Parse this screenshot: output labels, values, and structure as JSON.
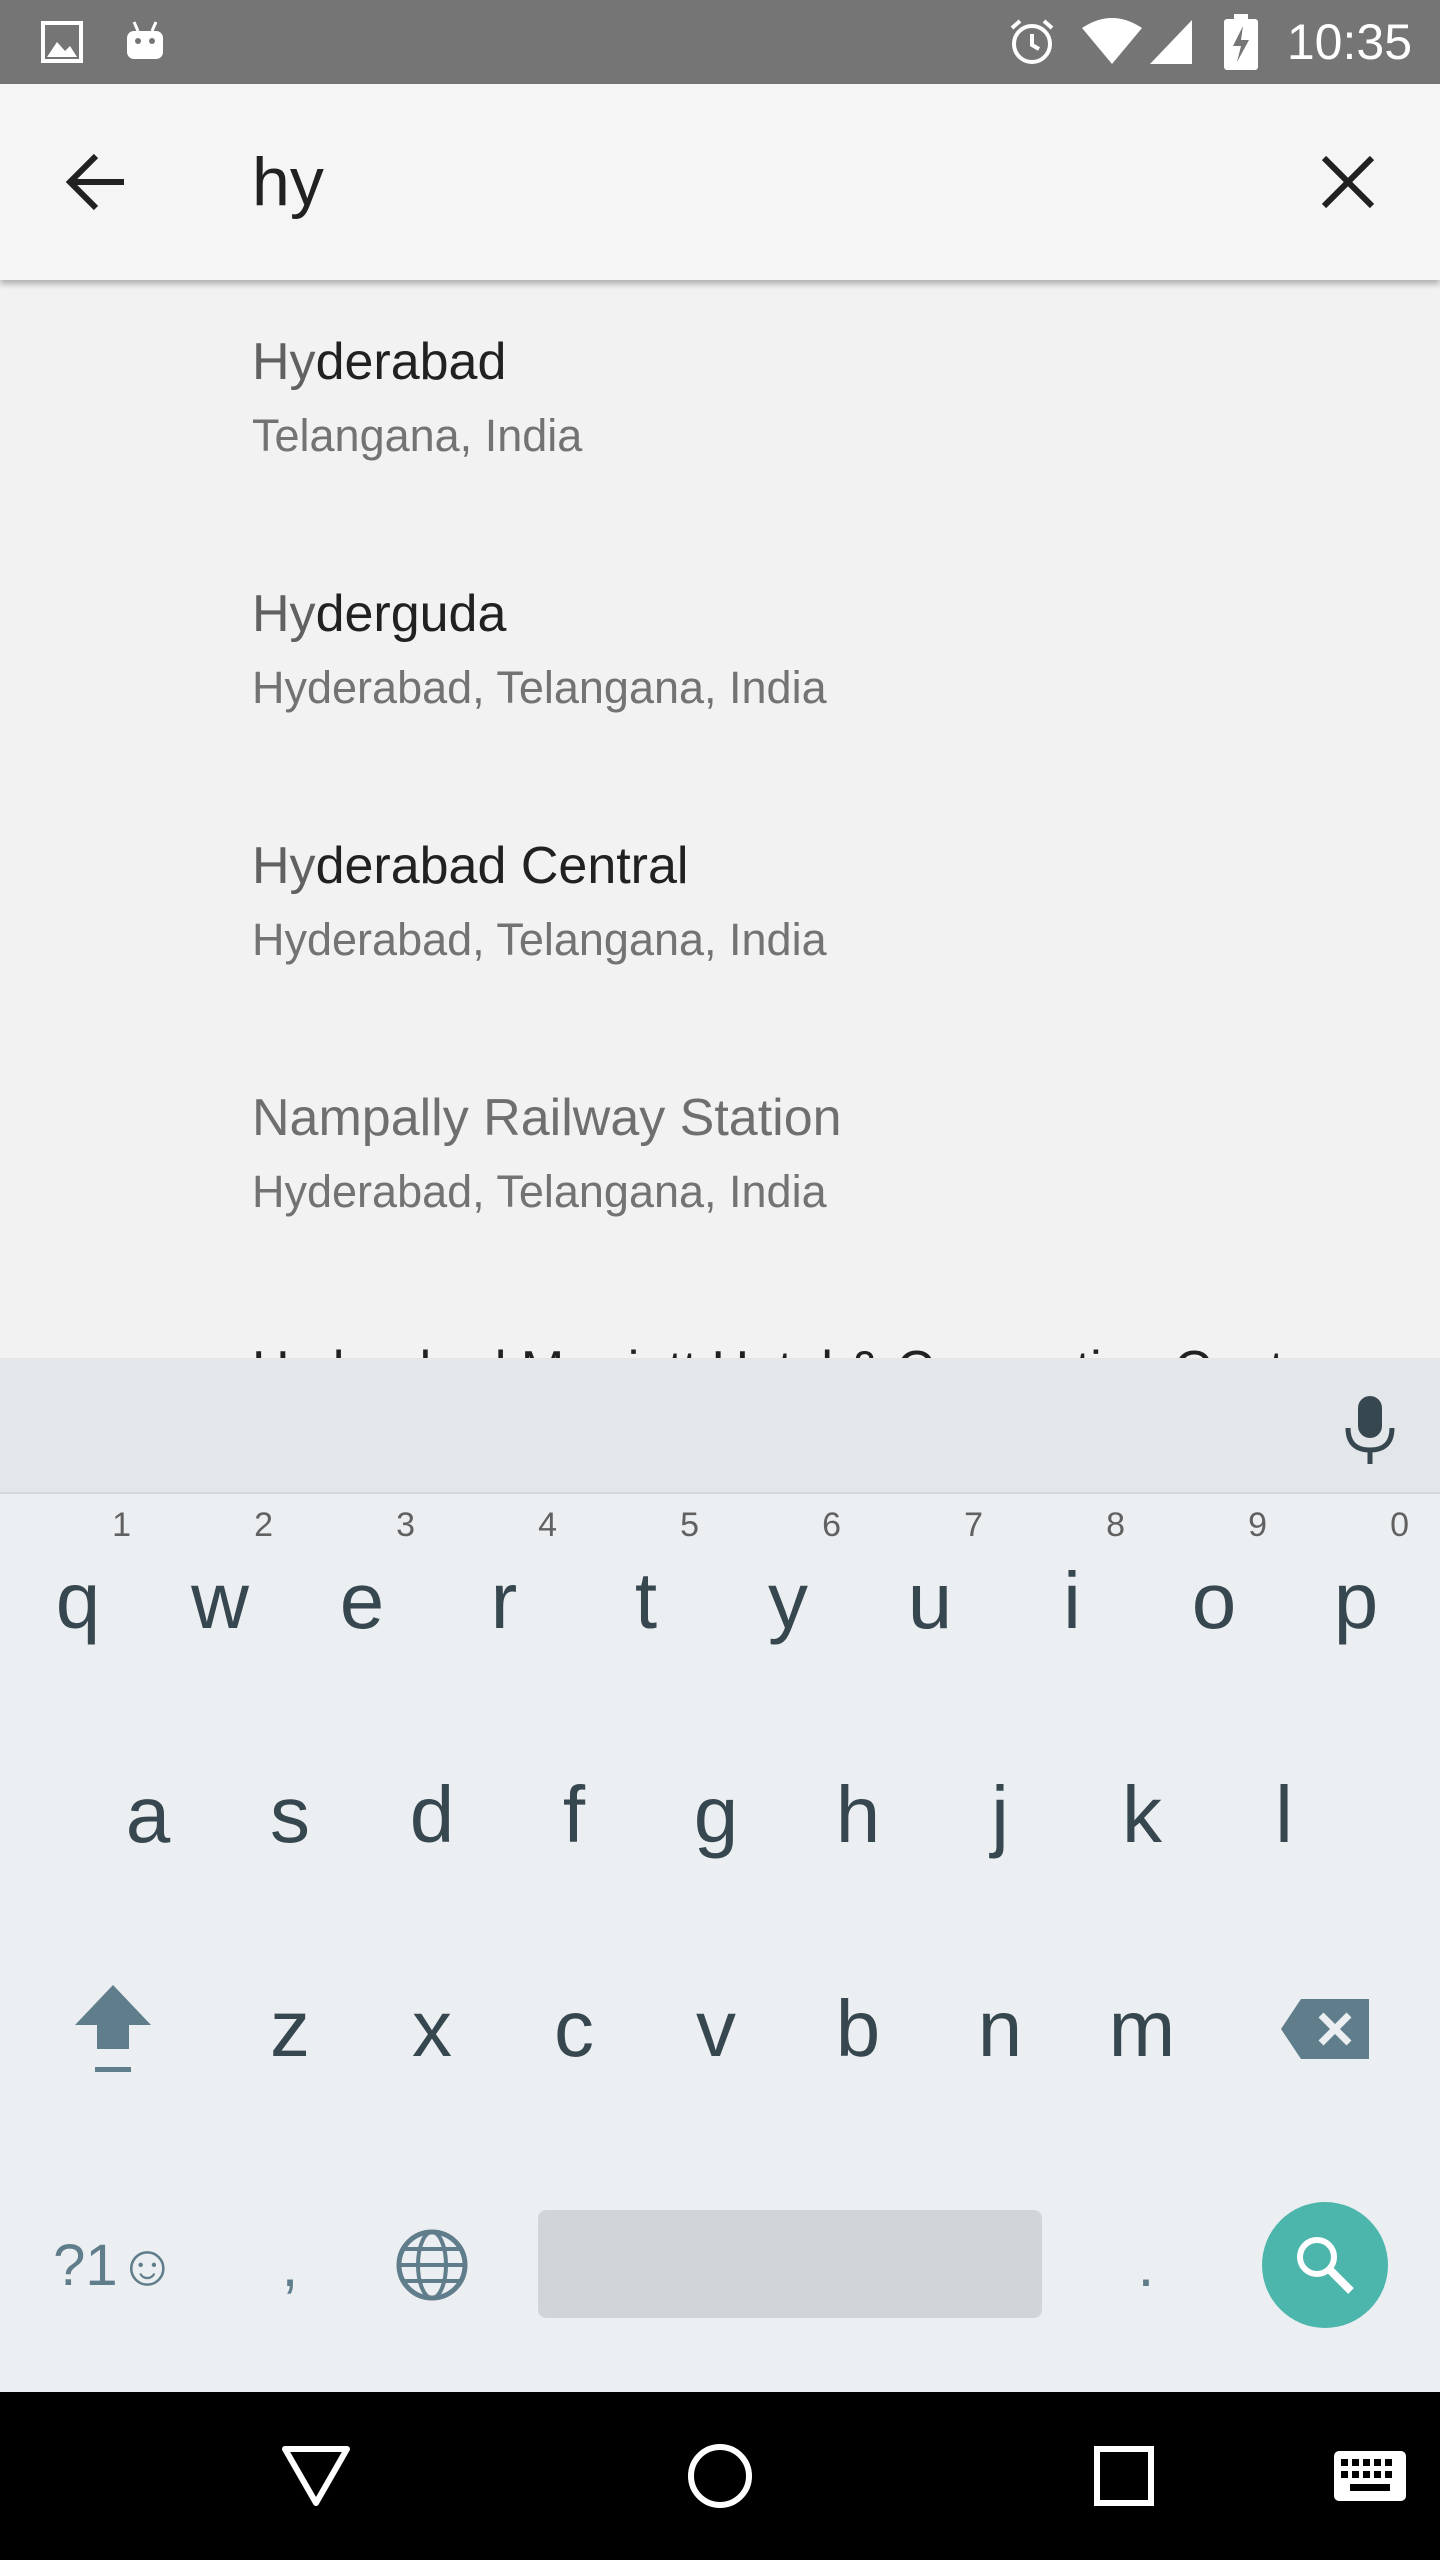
{
  "status_bar": {
    "time": "10:35",
    "left_icons": [
      "image-icon",
      "android-icon"
    ],
    "right_icons": [
      "alarm-icon",
      "wifi-icon",
      "signal-icon",
      "battery-icon"
    ]
  },
  "search": {
    "query": "hy",
    "back_icon": "arrow-back-icon",
    "clear_icon": "close-icon"
  },
  "results": [
    {
      "match": "Hy",
      "rest": "derabad",
      "subtitle": "Telangana, India"
    },
    {
      "match": "Hy",
      "rest": "derguda",
      "subtitle": "Hyderabad, Telangana, India"
    },
    {
      "match": "Hy",
      "rest": "derabad Central",
      "subtitle": "Hyderabad, Telangana, India"
    },
    {
      "match": "",
      "rest": "Nampally Railway Station",
      "subtitle": "Hyderabad, Telangana, India"
    },
    {
      "match": "",
      "rest": "Hyderabad Marriott Hotel & Convention Centre",
      "subtitle": ""
    }
  ],
  "keyboard": {
    "row1": [
      {
        "key": "q",
        "hint": "1"
      },
      {
        "key": "w",
        "hint": "2"
      },
      {
        "key": "e",
        "hint": "3"
      },
      {
        "key": "r",
        "hint": "4"
      },
      {
        "key": "t",
        "hint": "5"
      },
      {
        "key": "y",
        "hint": "6"
      },
      {
        "key": "u",
        "hint": "7"
      },
      {
        "key": "i",
        "hint": "8"
      },
      {
        "key": "o",
        "hint": "9"
      },
      {
        "key": "p",
        "hint": "0"
      }
    ],
    "row2": [
      "a",
      "s",
      "d",
      "f",
      "g",
      "h",
      "j",
      "k",
      "l"
    ],
    "row3": [
      "z",
      "x",
      "c",
      "v",
      "b",
      "n",
      "m"
    ],
    "symbols_label": "?1☺",
    "comma_label": ",",
    "period_label": ".",
    "mic_icon": "microphone-icon",
    "shift_icon": "shift-icon",
    "backspace_icon": "backspace-icon",
    "globe_icon": "globe-icon",
    "search_icon": "search-icon",
    "accent_color": "#4db6ac"
  },
  "nav_bar": {
    "buttons": [
      "back-triangle-icon",
      "home-circle-icon",
      "recents-square-icon",
      "keyboard-icon"
    ]
  }
}
